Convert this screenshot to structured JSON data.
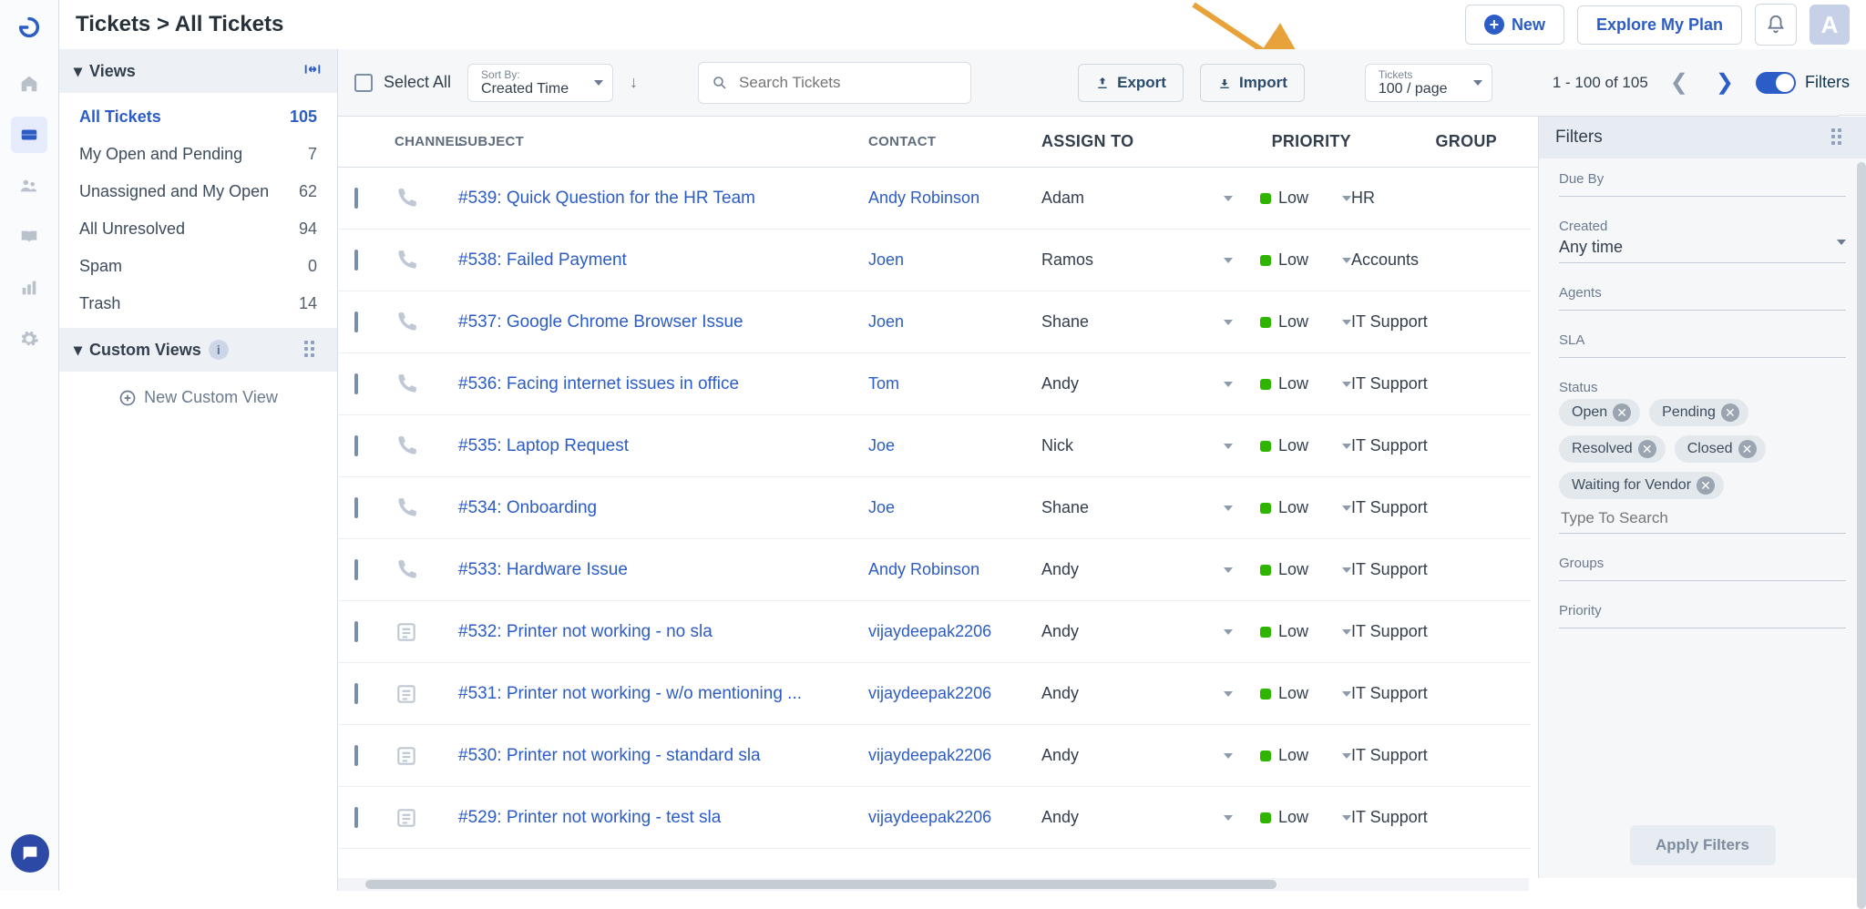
{
  "breadcrumb": "Tickets > All Tickets",
  "header": {
    "new_label": "New",
    "explore_label": "Explore My Plan",
    "avatar_letter": "A"
  },
  "sidebar": {
    "views_title": "Views",
    "custom_title": "Custom Views",
    "new_custom_label": "New Custom View",
    "items": [
      {
        "label": "All Tickets",
        "count": "105",
        "active": true
      },
      {
        "label": "My Open and Pending",
        "count": "7"
      },
      {
        "label": "Unassigned and My Open",
        "count": "62"
      },
      {
        "label": "All Unresolved",
        "count": "94"
      },
      {
        "label": "Spam",
        "count": "0"
      },
      {
        "label": "Trash",
        "count": "14"
      }
    ]
  },
  "toolbar": {
    "select_all": "Select All",
    "sort_label": "Sort By:",
    "sort_value": "Created Time",
    "search_placeholder": "Search Tickets",
    "export_label": "Export",
    "import_label": "Import",
    "pager_label": "Tickets",
    "pager_value": "100 / page",
    "page_info": "1 - 100 of 105",
    "filters_label": "Filters"
  },
  "columns": {
    "channel": "CHANNEL",
    "subject": "SUBJECT",
    "contact": "CONTACT",
    "assign": "ASSIGN TO",
    "priority": "PRIORITY",
    "group": "GROUP"
  },
  "rows": [
    {
      "channel": "phone",
      "subject": "#539: Quick Question for the HR Team",
      "contact": "Andy Robinson",
      "assign": "Adam",
      "priority": "Low",
      "group": "HR"
    },
    {
      "channel": "phone",
      "subject": "#538: Failed Payment",
      "contact": "Joen",
      "assign": "Ramos",
      "priority": "Low",
      "group": "Accounts"
    },
    {
      "channel": "phone",
      "subject": "#537: Google Chrome Browser Issue",
      "contact": "Joen",
      "assign": "Shane",
      "priority": "Low",
      "group": "IT Support"
    },
    {
      "channel": "phone",
      "subject": "#536: Facing internet issues in office",
      "contact": "Tom",
      "assign": "Andy",
      "priority": "Low",
      "group": "IT Support"
    },
    {
      "channel": "phone",
      "subject": "#535: Laptop Request",
      "contact": "Joe",
      "assign": "Nick",
      "priority": "Low",
      "group": "IT Support"
    },
    {
      "channel": "phone",
      "subject": "#534: Onboarding",
      "contact": "Joe",
      "assign": "Shane",
      "priority": "Low",
      "group": "IT Support"
    },
    {
      "channel": "phone",
      "subject": "#533: Hardware Issue",
      "contact": "Andy Robinson",
      "assign": "Andy",
      "priority": "Low",
      "group": "IT Support"
    },
    {
      "channel": "form",
      "subject": "#532: Printer not working - no sla",
      "contact": "vijaydeepak2206",
      "assign": "Andy",
      "priority": "Low",
      "group": "IT Support"
    },
    {
      "channel": "form",
      "subject": "#531: Printer not working - w/o mentioning ...",
      "contact": "vijaydeepak2206",
      "assign": "Andy",
      "priority": "Low",
      "group": "IT Support"
    },
    {
      "channel": "form",
      "subject": "#530: Printer not working - standard sla",
      "contact": "vijaydeepak2206",
      "assign": "Andy",
      "priority": "Low",
      "group": "IT Support"
    },
    {
      "channel": "form",
      "subject": "#529: Printer not working - test sla",
      "contact": "vijaydeepak2206",
      "assign": "Andy",
      "priority": "Low",
      "group": "IT Support"
    }
  ],
  "filters": {
    "title": "Filters",
    "due_by_label": "Due By",
    "created_label": "Created",
    "created_value": "Any time",
    "agents_label": "Agents",
    "sla_label": "SLA",
    "status_label": "Status",
    "status_chips": [
      "Open",
      "Pending",
      "Resolved",
      "Closed",
      "Waiting for Vendor"
    ],
    "type_search_placeholder": "Type To Search",
    "groups_label": "Groups",
    "priority_label": "Priority",
    "apply_label": "Apply Filters"
  }
}
